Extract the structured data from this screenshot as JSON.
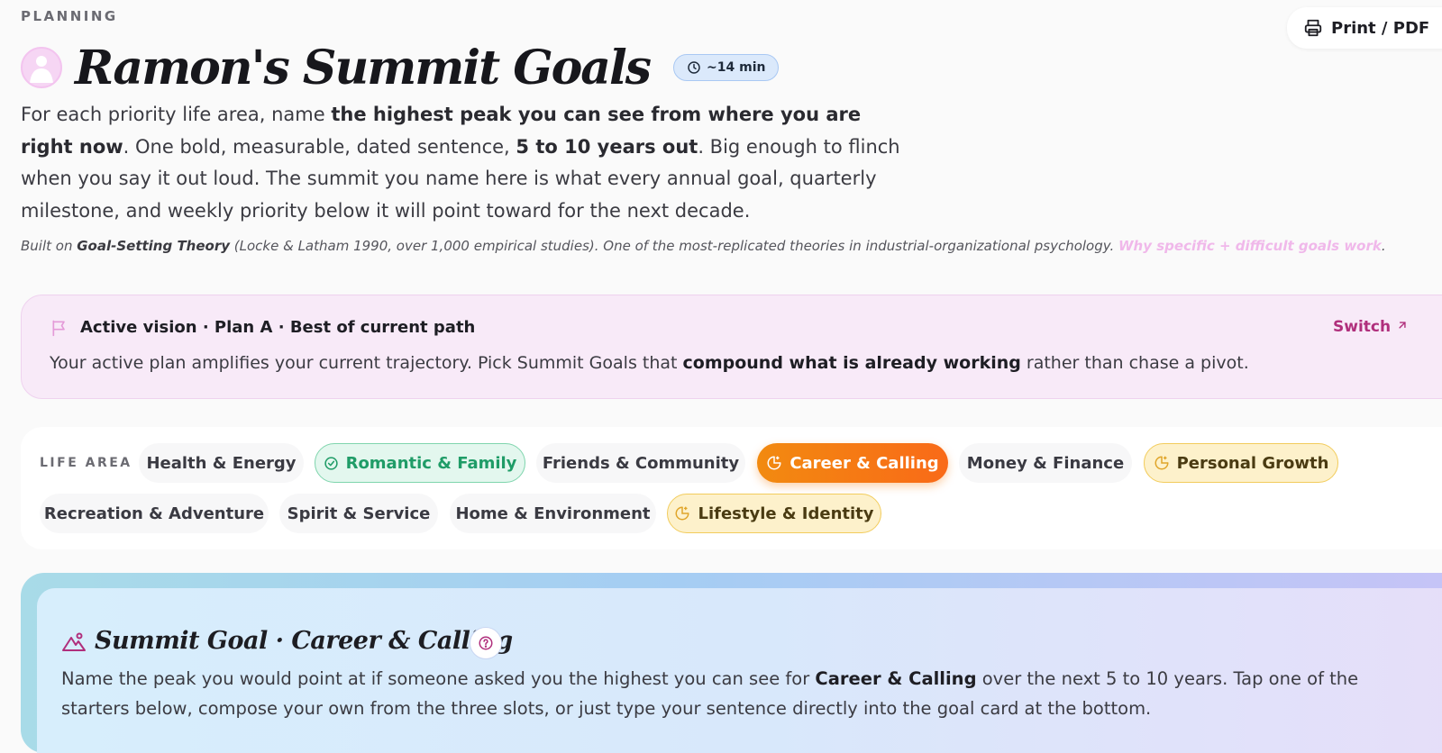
{
  "header": {
    "eyebrow": "PLANNING",
    "title": "Ramon's Summit Goals",
    "time_estimate": "~14 min",
    "print_label": "Print / PDF"
  },
  "intro": {
    "p1": "For each priority life area, name ",
    "p1_bold": "the highest peak you can see from where you are right now",
    "p2": ". One bold, measurable, dated sentence, ",
    "p2_bold": "5 to 10 years out",
    "p3": ". Big enough to flinch when you say it out loud. The summit you name here is what every annual goal, quarterly milestone, and weekly priority below it will point toward for the next decade."
  },
  "citation": {
    "prefix": "Built on ",
    "theory": "Goal-Setting Theory",
    "detail": " (Locke & Latham 1990, over 1,000 empirical studies). One of the most-replicated theories in industrial-organizational psychology. ",
    "link": "Why specific + difficult goals work",
    "suffix": "."
  },
  "vision": {
    "heading": "Active vision · Plan A · Best of current path",
    "switch_label": "Switch",
    "body_pre": "Your active plan amplifies your current trajectory. Pick Summit Goals that ",
    "body_bold": "compound what is already working",
    "body_post": " rather than chase a pivot."
  },
  "life_areas": {
    "label": "LIFE AREA",
    "items": [
      {
        "label": "Health & Energy",
        "state": "plain"
      },
      {
        "label": "Romantic & Family",
        "state": "done"
      },
      {
        "label": "Friends & Community",
        "state": "plain"
      },
      {
        "label": "Career & Calling",
        "state": "active"
      },
      {
        "label": "Money & Finance",
        "state": "plain"
      },
      {
        "label": "Personal Growth",
        "state": "partial"
      },
      {
        "label": "Recreation & Adventure",
        "state": "plain"
      },
      {
        "label": "Spirit & Service",
        "state": "plain"
      },
      {
        "label": "Home & Environment",
        "state": "plain"
      },
      {
        "label": "Lifestyle & Identity",
        "state": "partial"
      }
    ]
  },
  "summit": {
    "heading": "Summit Goal · Career & Calling",
    "body_pre": "Name the peak you would point at if someone asked you the highest you can see for ",
    "body_bold": "Career & Calling",
    "body_post": " over the next 5 to 10 years. Tap one of the starters below, compose your own from the three slots, or just type your sentence directly into the goal card at the bottom."
  },
  "colors": {
    "accent_pink": "#b02f7c",
    "active_orange": "#f5821a",
    "done_green": "#1f9c67",
    "partial_yellow": "#f2cc5c"
  }
}
